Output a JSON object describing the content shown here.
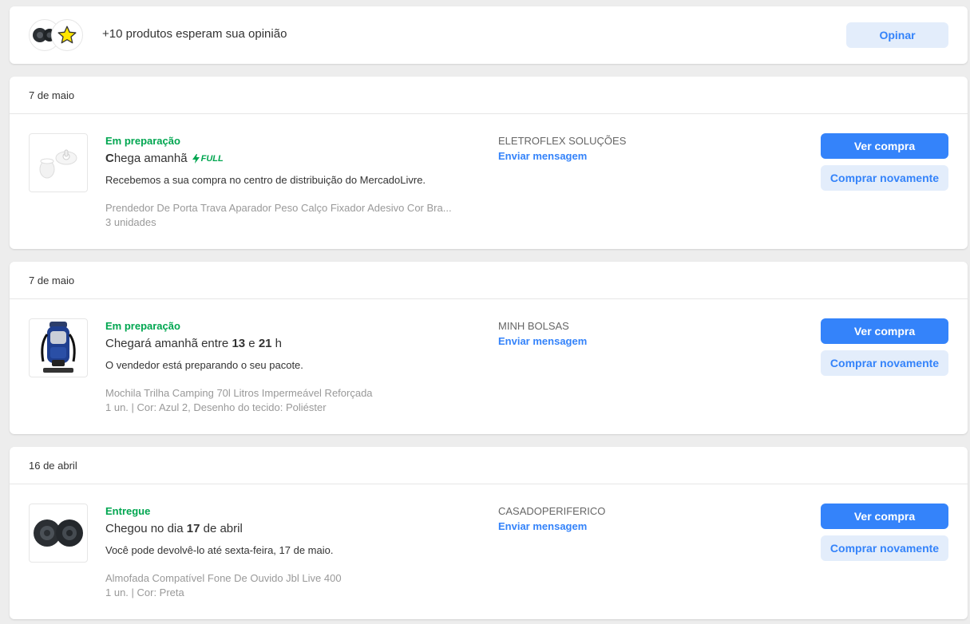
{
  "review": {
    "text": "+10 produtos esperam sua opinião",
    "button": "Opinar"
  },
  "orders": [
    {
      "date": "7 de maio",
      "status": "Em preparação",
      "title_prefix": "C",
      "title_main": "hega amanhã",
      "badge": "FULL",
      "description": "Recebemos a sua compra no centro de distribuição do MercadoLivre.",
      "product_name": "Prendedor De Porta Trava Aparador Peso Calço Fixador Adesivo Cor Bra...",
      "quantity": "3 unidades",
      "seller": "ELETROFLEX SOLUÇÕES",
      "message_link": "Enviar mensagem",
      "view_button": "Ver compra",
      "buy_again_button": "Comprar novamente"
    },
    {
      "date": "7 de maio",
      "status": "Em preparação",
      "title_parts": [
        "Chegará amanhã entre ",
        "13",
        " e ",
        "21",
        " h"
      ],
      "description": "O vendedor está preparando o seu pacote.",
      "product_name": "Mochila Trilha Camping 70l Litros Impermeável Reforçada",
      "quantity": "1 un. | Cor: Azul 2, Desenho do tecido: Poliéster",
      "seller": "MINH BOLSAS",
      "message_link": "Enviar mensagem",
      "view_button": "Ver compra",
      "buy_again_button": "Comprar novamente"
    },
    {
      "date": "16 de abril",
      "status": "Entregue",
      "title_parts": [
        "Chegou no dia ",
        "17",
        " de abril"
      ],
      "description": "Você pode devolvê-lo até sexta-feira, 17 de maio.",
      "product_name": "Almofada Compatível Fone De Ouvido Jbl Live 400",
      "quantity": "1 un. | Cor: Preta",
      "seller": "CASADOPERIFERICO",
      "message_link": "Enviar mensagem",
      "view_button": "Ver compra",
      "buy_again_button": "Comprar novamente"
    }
  ],
  "colors": {
    "accent": "#3483fa",
    "accent_light": "#e3edfb",
    "success": "#00a650",
    "muted": "#999999"
  },
  "icons": {
    "review_thumb_1": "headphone-pads-icon",
    "review_thumb_2": "star-icon",
    "full_badge": "lightning-icon"
  }
}
